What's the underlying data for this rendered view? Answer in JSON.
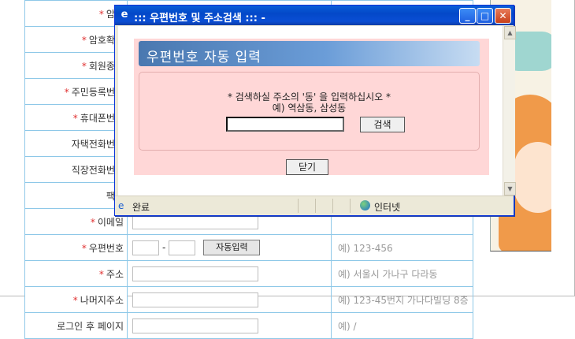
{
  "form": {
    "rows": [
      {
        "label": "암호",
        "required": true,
        "kind": "text",
        "hint": ""
      },
      {
        "label": "암호확인",
        "required": true,
        "kind": "text",
        "hint": ""
      },
      {
        "label": "회원종류",
        "required": true,
        "kind": "text",
        "hint": ""
      },
      {
        "label": "주민등록번호",
        "required": true,
        "kind": "text",
        "hint": ""
      },
      {
        "label": "휴대폰번호",
        "required": true,
        "kind": "text",
        "hint": ""
      },
      {
        "label": "자택전화번호",
        "required": false,
        "kind": "text",
        "hint": ""
      },
      {
        "label": "직장전화번호",
        "required": false,
        "kind": "text",
        "hint": ""
      },
      {
        "label": "팩스",
        "required": false,
        "kind": "text",
        "hint": ""
      },
      {
        "label": "이메일",
        "required": true,
        "kind": "text",
        "hint": ""
      },
      {
        "label": "우편번호",
        "required": true,
        "kind": "zip",
        "hint": "예) 123-456",
        "button": "자동입력"
      },
      {
        "label": "주소",
        "required": true,
        "kind": "text",
        "hint": "예) 서울시 가나구 다라동"
      },
      {
        "label": "나머지주소",
        "required": true,
        "kind": "text",
        "hint": "예) 123-45번지 가나다빌딩 8층"
      },
      {
        "label": "로그인 후 페이지",
        "required": false,
        "kind": "text",
        "hint": "예) /"
      }
    ],
    "zip_dash": "-"
  },
  "popup": {
    "title": "::: 우편번호 및 주소검색 ::: -",
    "banner": "우편번호 자동 입력",
    "guide_line1": "* 검색하실 주소의 '동' 을 입력하십시오 *",
    "guide_line2": "예) 역삼동, 삼성동",
    "dong_value": "",
    "search_button": "검색",
    "close_button": "닫기",
    "status_text": "완료",
    "zone_text": "인터넷"
  },
  "colors": {
    "required_star": "#e03030",
    "content_bg": "#ffd7d7",
    "titlebar": "#0a5fd8",
    "table_border": "#8ec8e8"
  }
}
